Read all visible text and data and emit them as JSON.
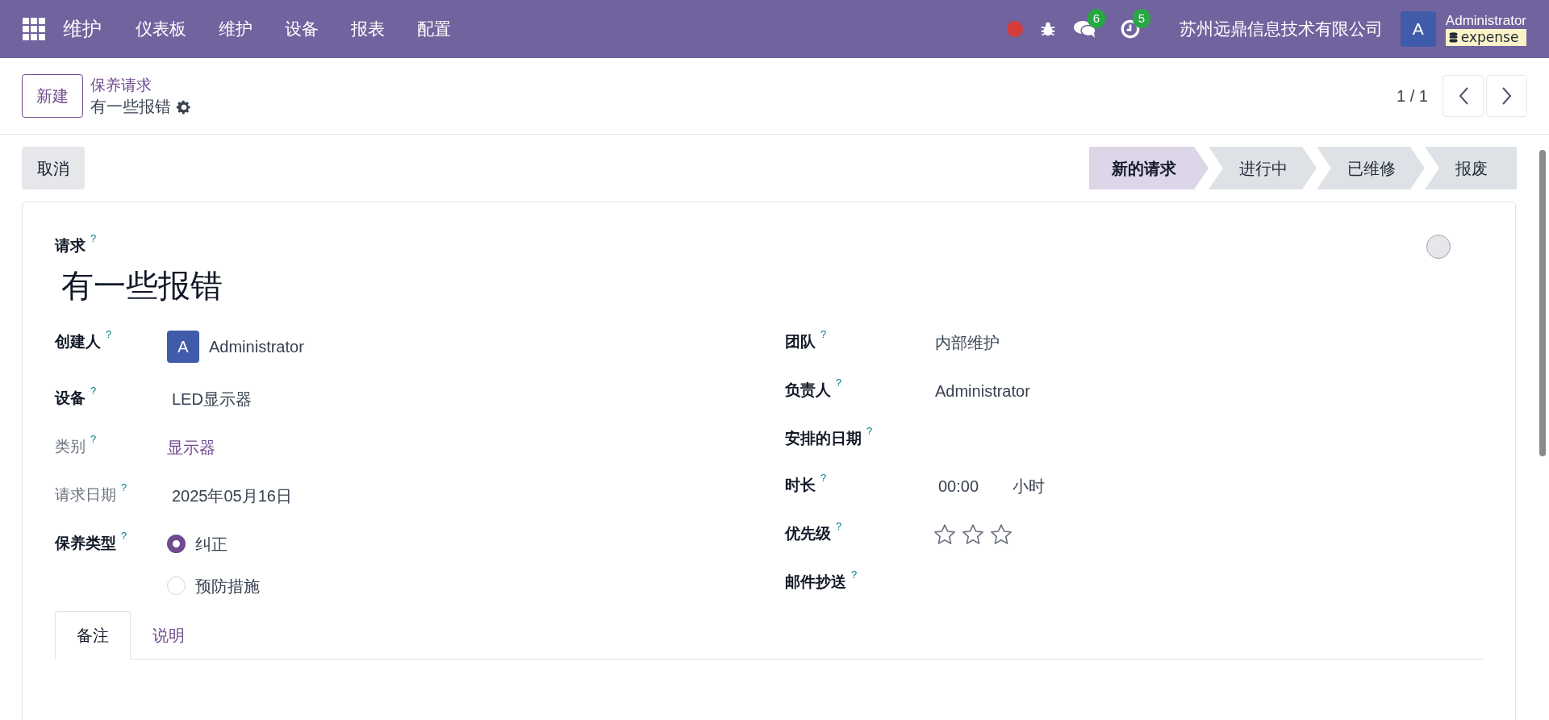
{
  "navbar": {
    "app_name": "维护",
    "menu": [
      "仪表板",
      "维护",
      "设备",
      "报表",
      "配置"
    ],
    "messages_count": "6",
    "activities_count": "5",
    "company": "苏州远鼎信息技术有限公司",
    "user_avatar": "A",
    "user_name": "Administrator",
    "database": "expense"
  },
  "control_panel": {
    "new_button": "新建",
    "breadcrumb_parent": "保养请求",
    "breadcrumb_current": "有一些报错",
    "pager": "1 / 1"
  },
  "actions": {
    "cancel_button": "取消"
  },
  "stages": [
    {
      "label": "新的请求",
      "selected": true
    },
    {
      "label": "进行中",
      "selected": false
    },
    {
      "label": "已维修",
      "selected": false
    },
    {
      "label": "报废",
      "selected": false
    }
  ],
  "form": {
    "title_label": "请求",
    "title_help": "?",
    "title": "有一些报错",
    "done": false,
    "left_fields": [
      {
        "label": "创建人",
        "help": "?",
        "bold": true,
        "kind": "user",
        "avatar": "A",
        "value": "Administrator"
      },
      {
        "label": "设备",
        "help": "?",
        "bold": true,
        "kind": "text",
        "value": "LED显示器"
      },
      {
        "label": "类别",
        "help": "?",
        "bold": false,
        "kind": "link",
        "value": "显示器"
      },
      {
        "label": "请求日期",
        "help": "?",
        "bold": false,
        "kind": "text",
        "value": "2025年05月16日"
      },
      {
        "label": "保养类型",
        "help": "?",
        "bold": true,
        "kind": "radio",
        "options": [
          {
            "label": "纠正",
            "selected": true
          },
          {
            "label": "预防措施",
            "selected": false
          }
        ]
      }
    ],
    "right_fields": [
      {
        "label": "团队",
        "help": "?",
        "bold": true,
        "kind": "text",
        "value": "内部维护"
      },
      {
        "label": "负责人",
        "help": "?",
        "bold": true,
        "kind": "text",
        "value": "Administrator"
      },
      {
        "label": "安排的日期",
        "help": "?",
        "bold": true,
        "kind": "empty"
      },
      {
        "label": "时长",
        "help": "?",
        "bold": true,
        "kind": "duration",
        "value": "00:00",
        "unit": "小时"
      },
      {
        "label": "优先级",
        "help": "?",
        "bold": true,
        "kind": "stars",
        "stars": 0
      },
      {
        "label": "邮件抄送",
        "help": "?",
        "bold": true,
        "kind": "empty"
      }
    ],
    "tabs": [
      {
        "label": "备注",
        "selected": true
      },
      {
        "label": "说明",
        "selected": false
      }
    ]
  }
}
